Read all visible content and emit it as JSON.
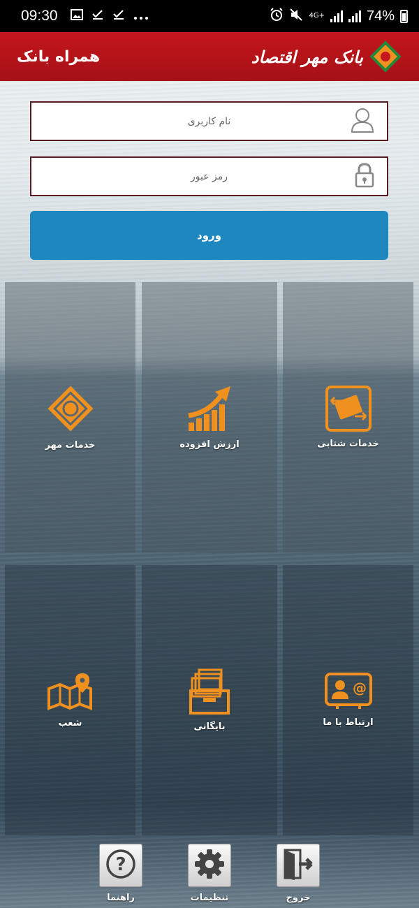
{
  "status_bar": {
    "time": "09:30",
    "network": "4G+",
    "battery": "74%",
    "left_icons": [
      "image-icon",
      "check-icon",
      "check-icon",
      "more-dots-icon"
    ]
  },
  "header": {
    "title": "همراه بانک",
    "logo_text": "بانک مهر اقتصاد",
    "color": "#c4161c"
  },
  "login": {
    "username_placeholder": "نام کاربری",
    "password_placeholder": "رمز عبور",
    "submit_label": "ورود",
    "button_color": "#1f87c0"
  },
  "tiles": [
    {
      "label": "خدمات مهر",
      "icon": "mehr-logo-icon"
    },
    {
      "label": "ارزش افزوده",
      "icon": "growth-chart-icon"
    },
    {
      "label": "خدمات شتابی",
      "icon": "card-transfer-icon"
    },
    {
      "label": "شعب",
      "icon": "map-pin-icon"
    },
    {
      "label": "بایگانی",
      "icon": "archive-icon"
    },
    {
      "label": "ارتباط با ما",
      "icon": "contact-icon"
    }
  ],
  "bottom_bar": [
    {
      "label": "راهنما",
      "icon": "help-icon"
    },
    {
      "label": "تنظیمات",
      "icon": "settings-gear-icon"
    },
    {
      "label": "خروج",
      "icon": "exit-door-icon"
    }
  ],
  "accent_color": "#f0901e"
}
